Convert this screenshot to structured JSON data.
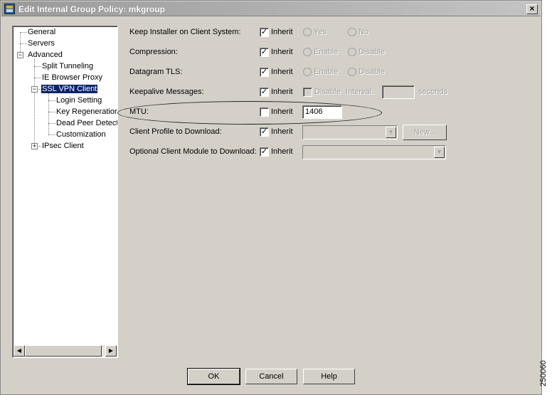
{
  "window": {
    "title": "Edit Internal Group Policy: mkgroup"
  },
  "tree": {
    "items": [
      {
        "label": "General"
      },
      {
        "label": "Servers"
      },
      {
        "label": "Advanced"
      },
      {
        "label": "Split Tunneling"
      },
      {
        "label": "IE Browser Proxy"
      },
      {
        "label": "SSL VPN Client",
        "selected": true
      },
      {
        "label": "Login Setting"
      },
      {
        "label": "Key Regeneration"
      },
      {
        "label": "Dead Peer Detecti"
      },
      {
        "label": "Customization"
      },
      {
        "label": "IPsec Client"
      }
    ]
  },
  "form": {
    "inherit_label": "Inherit",
    "keep_installer": {
      "label": "Keep Installer on Client System:",
      "inherit": true,
      "opt1": "Yes",
      "opt2": "No"
    },
    "compression": {
      "label": "Compression:",
      "inherit": true,
      "opt1": "Enable",
      "opt2": "Disable"
    },
    "datagram_tls": {
      "label": "Datagram TLS:",
      "inherit": true,
      "opt1": "Enable",
      "opt2": "Disable"
    },
    "keepalive": {
      "label": "Keepalive Messages:",
      "inherit": true,
      "disable_label": "Disable",
      "interval_label": "Interval:",
      "interval_value": "",
      "unit": "seconds"
    },
    "mtu": {
      "label": "MTU:",
      "inherit": false,
      "value": "1406"
    },
    "client_profile": {
      "label": "Client Profile to Download:",
      "inherit": true,
      "selected": "",
      "new_button": "New..."
    },
    "optional_module": {
      "label": "Optional Client Module to Download:",
      "inherit": true,
      "selected": ""
    }
  },
  "buttons": {
    "ok": "OK",
    "cancel": "Cancel",
    "help": "Help"
  },
  "figure_id": "250060"
}
